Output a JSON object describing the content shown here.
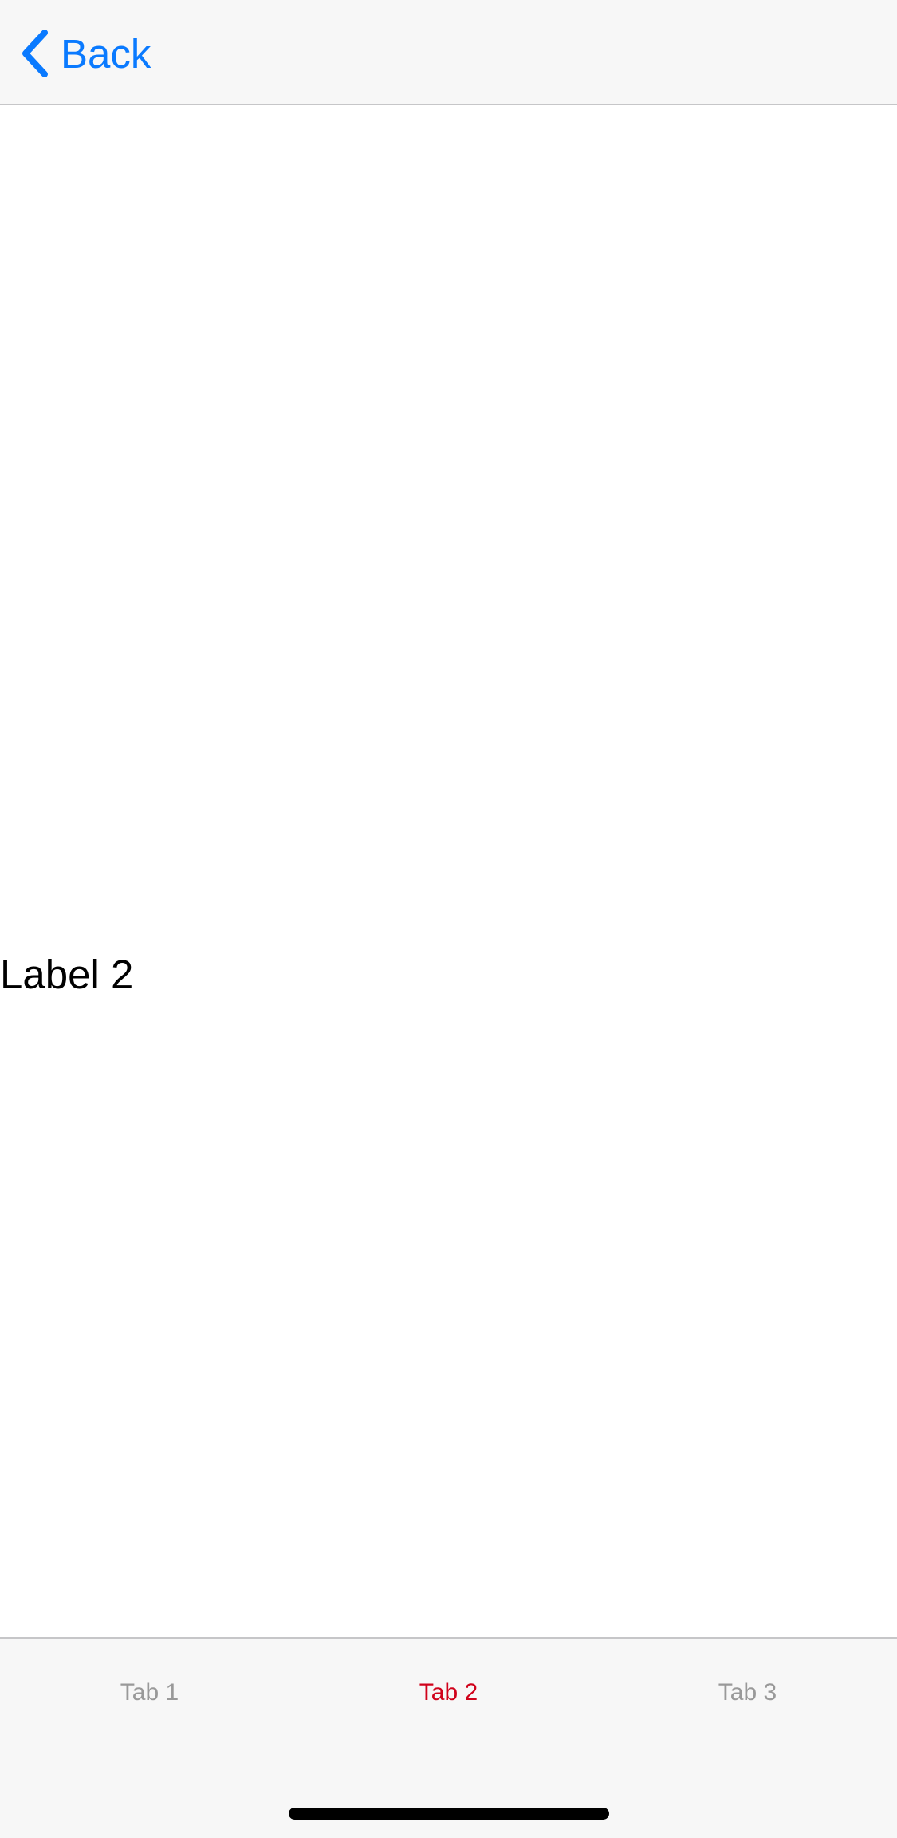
{
  "nav": {
    "back_label": "Back",
    "back_icon": "chevron-left-icon",
    "accent_color": "#0a7aff"
  },
  "content": {
    "label": "Label 2"
  },
  "tabs": {
    "selected_color": "#d0021b",
    "unselected_color": "#999999",
    "items": [
      {
        "label": "Tab 1",
        "selected": false
      },
      {
        "label": "Tab 2",
        "selected": true
      },
      {
        "label": "Tab 3",
        "selected": false
      }
    ]
  }
}
